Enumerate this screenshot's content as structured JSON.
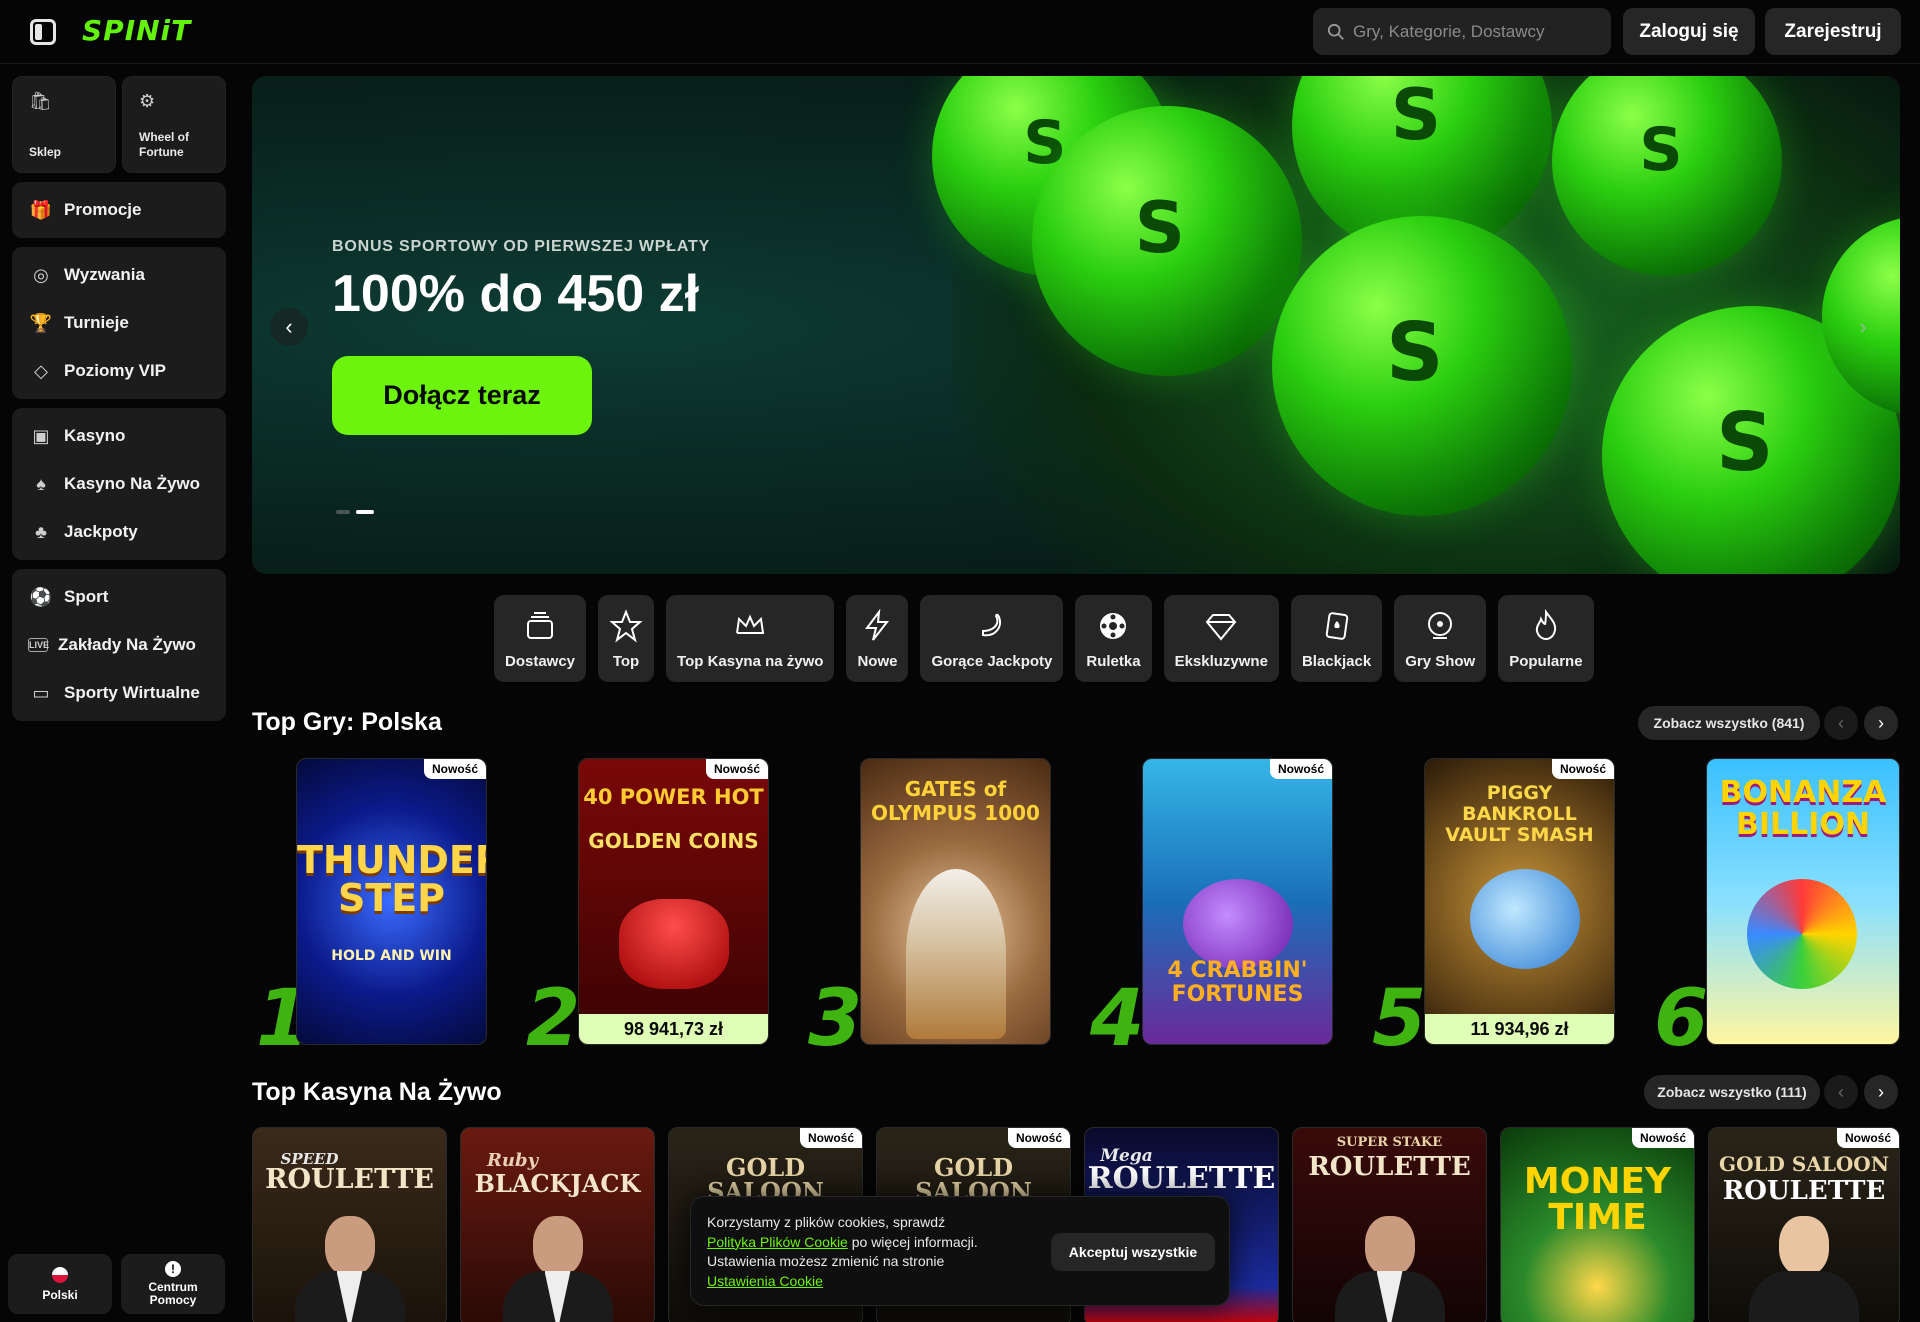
{
  "header": {
    "logo": "SPINiT",
    "search_placeholder": "Gry, Kategorie, Dostawcy",
    "login": "Zaloguj się",
    "register": "Zarejestruj"
  },
  "sidebar": {
    "quick": [
      {
        "label": "Sklep",
        "icon": "bag-icon"
      },
      {
        "label": "Wheel of Fortune",
        "icon": "wheel-icon"
      }
    ],
    "groups": [
      [
        {
          "label": "Promocje",
          "icon": "gift-icon"
        }
      ],
      [
        {
          "label": "Wyzwania",
          "icon": "target-icon"
        },
        {
          "label": "Turnieje",
          "icon": "trophy-icon"
        },
        {
          "label": "Poziomy VIP",
          "icon": "diamond-icon"
        }
      ],
      [
        {
          "label": "Kasyno",
          "icon": "slot-icon"
        },
        {
          "label": "Kasyno Na Żywo",
          "icon": "cards-icon"
        },
        {
          "label": "Jackpoty",
          "icon": "clover-icon"
        }
      ],
      [
        {
          "label": "Sport",
          "icon": "ball-icon"
        },
        {
          "label": "Zakłady Na Żywo",
          "icon": "live-icon"
        },
        {
          "label": "Sporty Wirtualne",
          "icon": "monitor-icon"
        }
      ]
    ],
    "language": "Polski",
    "help": "Centrum Pomocy"
  },
  "hero": {
    "subtitle": "BONUS SPORTOWY OD PIERWSZEJ WPŁATY",
    "title": "100% do 450 zł",
    "cta": "Dołącz teraz",
    "slides_total": 2,
    "slide_active": 2
  },
  "categories": [
    "Dostawcy",
    "Top",
    "Top Kasyna na żywo",
    "Nowe",
    "Gorące Jackpoty",
    "Ruletka",
    "Ekskluzywne",
    "Blackjack",
    "Gry Show",
    "Popularne"
  ],
  "top_games": {
    "title": "Top Gry: Polska",
    "see_all": "Zobacz wszystko (841)",
    "games": [
      {
        "rank": "1",
        "name": "THUNDER STEP",
        "sub": "HOLD AND WIN",
        "badge": "Nowość",
        "jackpot": ""
      },
      {
        "rank": "2",
        "name": "40 POWER HOT",
        "sub": "GOLDEN COINS",
        "badge": "Nowość",
        "jackpot": "98 941,73 zł"
      },
      {
        "rank": "3",
        "name": "GATES of OLYMPUS 1000",
        "sub": "",
        "badge": "",
        "jackpot": ""
      },
      {
        "rank": "4",
        "name": "4 CRABBIN' FORTUNES",
        "sub": "",
        "badge": "Nowość",
        "jackpot": ""
      },
      {
        "rank": "5",
        "name": "PIGGY BANKROLL VAULT SMASH",
        "sub": "",
        "badge": "Nowość",
        "jackpot": "11 934,96 zł"
      },
      {
        "rank": "6",
        "name": "BONANZA BILLION",
        "sub": "",
        "badge": "",
        "jackpot": ""
      }
    ]
  },
  "live": {
    "title": "Top Kasyna Na Żywo",
    "see_all": "Zobacz wszystko (111)",
    "games": [
      {
        "top": "SPEED",
        "name": "ROULETTE",
        "badge": ""
      },
      {
        "top": "Ruby",
        "name": "BLACKJACK",
        "badge": ""
      },
      {
        "top": "",
        "name": "GOLD SALOON",
        "badge": "Nowość"
      },
      {
        "top": "",
        "name": "GOLD SALOON",
        "badge": "Nowość"
      },
      {
        "top": "Mega",
        "name": "ROULETTE",
        "badge": ""
      },
      {
        "top": "SUPER STAKE",
        "name": "ROULETTE",
        "badge": ""
      },
      {
        "top": "",
        "name": "MONEY TIME",
        "badge": "Nowość"
      },
      {
        "top": "GOLD SALOON",
        "name": "ROULETTE",
        "badge": "Nowość"
      }
    ]
  },
  "cookie": {
    "line1": "Korzystamy z plików cookies, sprawdź",
    "link1": "Polityka Plików Cookie",
    "line2": " po więcej informacji.",
    "line3": "Ustawienia możesz zmienić na stronie",
    "link2": "Ustawienia Cookie",
    "accept": "Akceptuj wszystkie"
  }
}
